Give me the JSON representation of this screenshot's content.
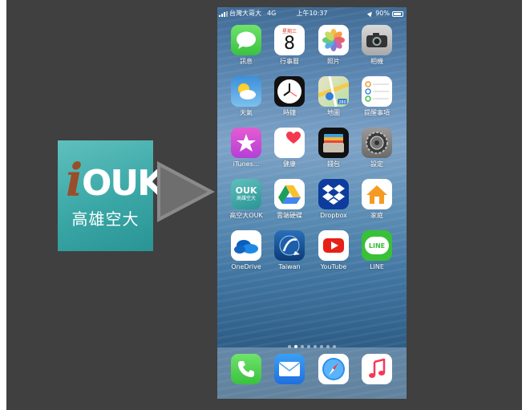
{
  "logo": {
    "brand_i": "i",
    "brand_ouk": "OUK",
    "subtitle": "高雄空大"
  },
  "status_bar": {
    "carrier": "台灣大哥大",
    "network": "4G",
    "time": "上午10:37",
    "battery": "90%"
  },
  "apps": [
    {
      "label": "訊息",
      "icon": "messages-icon"
    },
    {
      "label": "行事曆",
      "icon": "calendar-icon",
      "weekday": "星期三",
      "day": "8"
    },
    {
      "label": "照片",
      "icon": "photos-icon"
    },
    {
      "label": "相機",
      "icon": "camera-icon"
    },
    {
      "label": "天氣",
      "icon": "weather-icon"
    },
    {
      "label": "時鐘",
      "icon": "clock-icon"
    },
    {
      "label": "地圖",
      "icon": "maps-icon",
      "badge": "280"
    },
    {
      "label": "提醒事項",
      "icon": "reminders-icon"
    },
    {
      "label": "iTunes...",
      "icon": "itunes-store-icon"
    },
    {
      "label": "健康",
      "icon": "health-icon"
    },
    {
      "label": "錢包",
      "icon": "wallet-icon"
    },
    {
      "label": "設定",
      "icon": "settings-icon"
    },
    {
      "label": "高空大OUK",
      "icon": "ouk-app-icon",
      "icon_text": "OUK",
      "icon_sub": "高雄空大"
    },
    {
      "label": "雲端硬碟",
      "icon": "google-drive-icon"
    },
    {
      "label": "Dropbox",
      "icon": "dropbox-icon"
    },
    {
      "label": "家庭",
      "icon": "home-icon"
    },
    {
      "label": "OneDrive",
      "icon": "onedrive-icon"
    },
    {
      "label": "Taiwan",
      "icon": "taiwan-app-icon"
    },
    {
      "label": "YouTube",
      "icon": "youtube-icon"
    },
    {
      "label": "LINE",
      "icon": "line-icon",
      "icon_text": "LINE"
    }
  ],
  "page_dots": {
    "count": 8,
    "active": 1
  },
  "dock": [
    {
      "icon": "phone-icon"
    },
    {
      "icon": "mail-icon"
    },
    {
      "icon": "safari-icon"
    },
    {
      "icon": "music-icon"
    }
  ],
  "colors": {
    "background": "#404040",
    "logo_teal": "#3aa7a6",
    "arrow": "#8a8a8a"
  }
}
